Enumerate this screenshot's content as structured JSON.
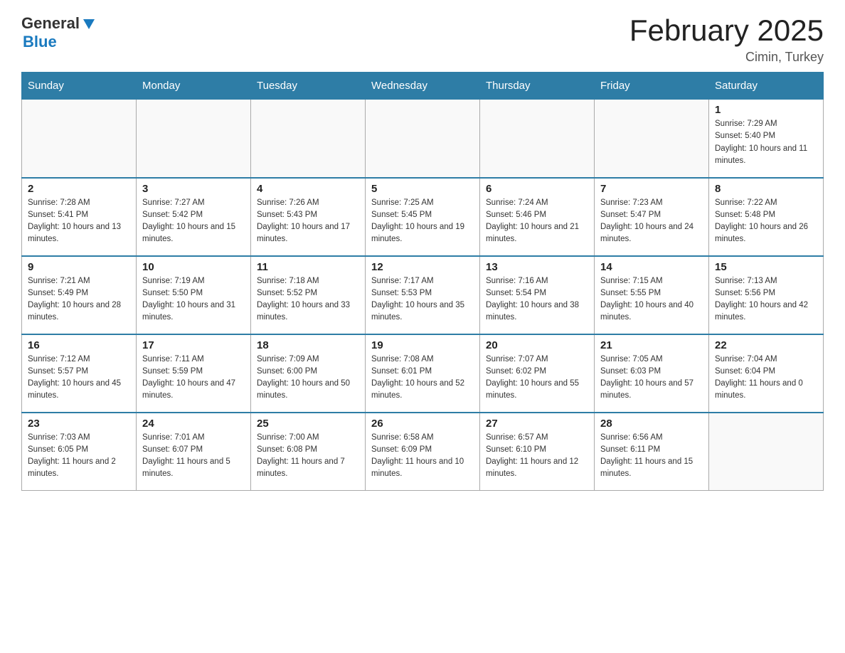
{
  "header": {
    "logo_general": "General",
    "logo_blue": "Blue",
    "logo_arrow": "▼",
    "month_title": "February 2025",
    "location": "Cimin, Turkey"
  },
  "days_of_week": [
    "Sunday",
    "Monday",
    "Tuesday",
    "Wednesday",
    "Thursday",
    "Friday",
    "Saturday"
  ],
  "weeks": [
    [
      {
        "day": "",
        "info": ""
      },
      {
        "day": "",
        "info": ""
      },
      {
        "day": "",
        "info": ""
      },
      {
        "day": "",
        "info": ""
      },
      {
        "day": "",
        "info": ""
      },
      {
        "day": "",
        "info": ""
      },
      {
        "day": "1",
        "info": "Sunrise: 7:29 AM\nSunset: 5:40 PM\nDaylight: 10 hours and 11 minutes."
      }
    ],
    [
      {
        "day": "2",
        "info": "Sunrise: 7:28 AM\nSunset: 5:41 PM\nDaylight: 10 hours and 13 minutes."
      },
      {
        "day": "3",
        "info": "Sunrise: 7:27 AM\nSunset: 5:42 PM\nDaylight: 10 hours and 15 minutes."
      },
      {
        "day": "4",
        "info": "Sunrise: 7:26 AM\nSunset: 5:43 PM\nDaylight: 10 hours and 17 minutes."
      },
      {
        "day": "5",
        "info": "Sunrise: 7:25 AM\nSunset: 5:45 PM\nDaylight: 10 hours and 19 minutes."
      },
      {
        "day": "6",
        "info": "Sunrise: 7:24 AM\nSunset: 5:46 PM\nDaylight: 10 hours and 21 minutes."
      },
      {
        "day": "7",
        "info": "Sunrise: 7:23 AM\nSunset: 5:47 PM\nDaylight: 10 hours and 24 minutes."
      },
      {
        "day": "8",
        "info": "Sunrise: 7:22 AM\nSunset: 5:48 PM\nDaylight: 10 hours and 26 minutes."
      }
    ],
    [
      {
        "day": "9",
        "info": "Sunrise: 7:21 AM\nSunset: 5:49 PM\nDaylight: 10 hours and 28 minutes."
      },
      {
        "day": "10",
        "info": "Sunrise: 7:19 AM\nSunset: 5:50 PM\nDaylight: 10 hours and 31 minutes."
      },
      {
        "day": "11",
        "info": "Sunrise: 7:18 AM\nSunset: 5:52 PM\nDaylight: 10 hours and 33 minutes."
      },
      {
        "day": "12",
        "info": "Sunrise: 7:17 AM\nSunset: 5:53 PM\nDaylight: 10 hours and 35 minutes."
      },
      {
        "day": "13",
        "info": "Sunrise: 7:16 AM\nSunset: 5:54 PM\nDaylight: 10 hours and 38 minutes."
      },
      {
        "day": "14",
        "info": "Sunrise: 7:15 AM\nSunset: 5:55 PM\nDaylight: 10 hours and 40 minutes."
      },
      {
        "day": "15",
        "info": "Sunrise: 7:13 AM\nSunset: 5:56 PM\nDaylight: 10 hours and 42 minutes."
      }
    ],
    [
      {
        "day": "16",
        "info": "Sunrise: 7:12 AM\nSunset: 5:57 PM\nDaylight: 10 hours and 45 minutes."
      },
      {
        "day": "17",
        "info": "Sunrise: 7:11 AM\nSunset: 5:59 PM\nDaylight: 10 hours and 47 minutes."
      },
      {
        "day": "18",
        "info": "Sunrise: 7:09 AM\nSunset: 6:00 PM\nDaylight: 10 hours and 50 minutes."
      },
      {
        "day": "19",
        "info": "Sunrise: 7:08 AM\nSunset: 6:01 PM\nDaylight: 10 hours and 52 minutes."
      },
      {
        "day": "20",
        "info": "Sunrise: 7:07 AM\nSunset: 6:02 PM\nDaylight: 10 hours and 55 minutes."
      },
      {
        "day": "21",
        "info": "Sunrise: 7:05 AM\nSunset: 6:03 PM\nDaylight: 10 hours and 57 minutes."
      },
      {
        "day": "22",
        "info": "Sunrise: 7:04 AM\nSunset: 6:04 PM\nDaylight: 11 hours and 0 minutes."
      }
    ],
    [
      {
        "day": "23",
        "info": "Sunrise: 7:03 AM\nSunset: 6:05 PM\nDaylight: 11 hours and 2 minutes."
      },
      {
        "day": "24",
        "info": "Sunrise: 7:01 AM\nSunset: 6:07 PM\nDaylight: 11 hours and 5 minutes."
      },
      {
        "day": "25",
        "info": "Sunrise: 7:00 AM\nSunset: 6:08 PM\nDaylight: 11 hours and 7 minutes."
      },
      {
        "day": "26",
        "info": "Sunrise: 6:58 AM\nSunset: 6:09 PM\nDaylight: 11 hours and 10 minutes."
      },
      {
        "day": "27",
        "info": "Sunrise: 6:57 AM\nSunset: 6:10 PM\nDaylight: 11 hours and 12 minutes."
      },
      {
        "day": "28",
        "info": "Sunrise: 6:56 AM\nSunset: 6:11 PM\nDaylight: 11 hours and 15 minutes."
      },
      {
        "day": "",
        "info": ""
      }
    ]
  ]
}
